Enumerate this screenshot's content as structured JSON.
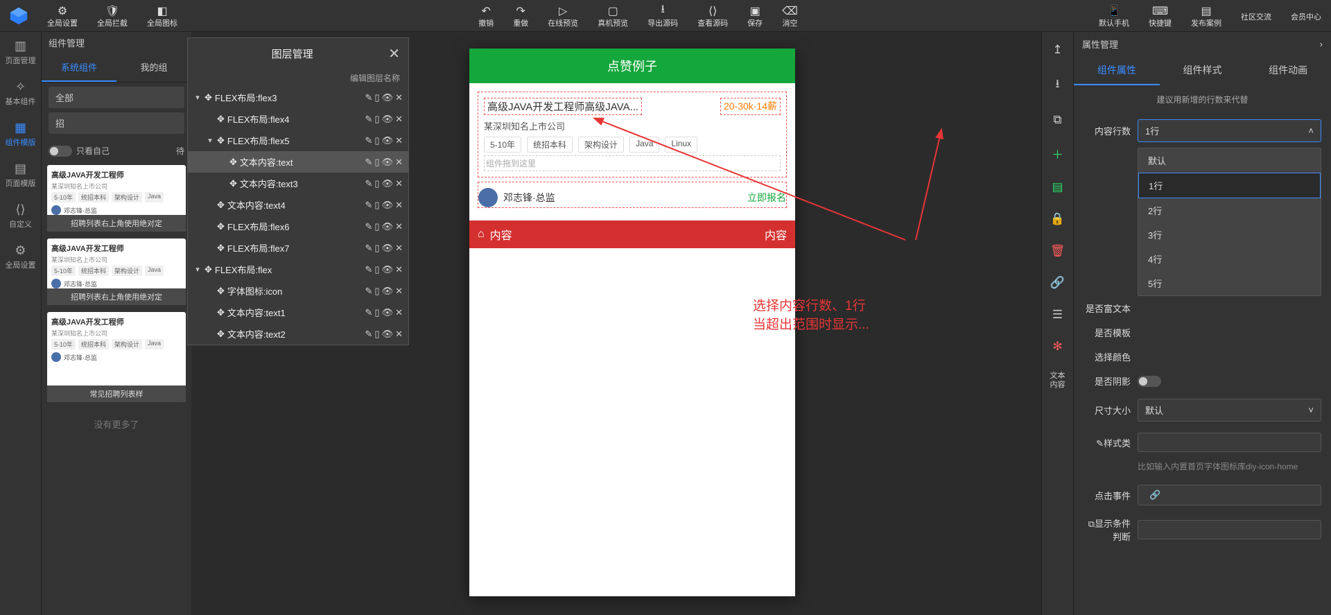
{
  "topbar": {
    "groupA": [
      "全局设置",
      "全局拦截",
      "全局图标"
    ],
    "center": [
      "撤销",
      "重做",
      "在线预览",
      "真机预览",
      "导出源码",
      "查看源码",
      "保存",
      "消空"
    ],
    "right": [
      "默认手机",
      "快捷键",
      "发布案例",
      "社区交流",
      "会员中心"
    ]
  },
  "left_rail": {
    "items": [
      "页面管理",
      "基本组件",
      "组件模版",
      "页面模版",
      "自定义",
      "全局设置"
    ],
    "active": 2
  },
  "comp_panel": {
    "title": "组件管理",
    "tabs": {
      "a": "系统组件",
      "b": "我的组"
    },
    "filter_all": "全部",
    "filter_search": "招",
    "toggle_label": "只看自己",
    "toggle_suffix": "待",
    "card": {
      "title": "高级JAVA开发工程师",
      "company": "某深圳知名上市公司",
      "tags": [
        "5-10年",
        "统招本科",
        "架构设计",
        "Java"
      ],
      "person": "邓志锋·总监"
    },
    "caption1": "招聘列表右上角使用绝对定",
    "caption2": "招聘列表右上角使用绝对定",
    "caption3": "常见招聘列表样",
    "nomore": "没有更多了"
  },
  "layer": {
    "title": "图层管理",
    "edit": "编辑图层名称",
    "rows": [
      {
        "depth": 0,
        "exp": "▾",
        "label": "FLEX布局:flex3",
        "sel": false
      },
      {
        "depth": 1,
        "exp": "",
        "label": "FLEX布局:flex4",
        "sel": false
      },
      {
        "depth": 1,
        "exp": "▾",
        "label": "FLEX布局:flex5",
        "sel": false
      },
      {
        "depth": 2,
        "exp": "",
        "label": "文本内容:text",
        "sel": true
      },
      {
        "depth": 2,
        "exp": "",
        "label": "文本内容:text3",
        "sel": false
      },
      {
        "depth": 1,
        "exp": "",
        "label": "文本内容:text4",
        "sel": false
      },
      {
        "depth": 1,
        "exp": "",
        "label": "FLEX布局:flex6",
        "sel": false
      },
      {
        "depth": 1,
        "exp": "",
        "label": "FLEX布局:flex7",
        "sel": false
      },
      {
        "depth": 0,
        "exp": "▾",
        "label": "FLEX布局:flex",
        "sel": false
      },
      {
        "depth": 1,
        "exp": "",
        "label": "字体图标:icon",
        "sel": false
      },
      {
        "depth": 1,
        "exp": "",
        "label": "文本内容:text1",
        "sel": false
      },
      {
        "depth": 1,
        "exp": "",
        "label": "文本内容:text2",
        "sel": false
      }
    ]
  },
  "phone": {
    "header": "点赞例子",
    "job_title": "高级JAVA开发工程师高级JAVA...",
    "salary": "20-30k·14薪",
    "company": "某深圳知名上市公司",
    "tags": [
      "5-10年",
      "统招本科",
      "架构设计",
      "Java",
      "Linux"
    ],
    "drag_hint": "组件拖到这里",
    "person": "邓志锋·总监",
    "apply": "立即报名",
    "red_label": "内容",
    "red_right": "内容"
  },
  "anno": {
    "line1": "选择内容行数、1行",
    "line2": "当超出范围时显示..."
  },
  "rvbar_text": "文本\n内容",
  "rpanel": {
    "title": "属性管理",
    "tabs": [
      "组件属性",
      "组件样式",
      "组件动画"
    ],
    "hint": "建议用新增的行数来代替",
    "f_lines": {
      "label": "内容行数",
      "value": "1行",
      "options": [
        "默认",
        "1行",
        "2行",
        "3行",
        "4行",
        "5行"
      ],
      "selected": "1行"
    },
    "f_rich": {
      "label": "是否富文本"
    },
    "f_tpl": {
      "label": "是否模板"
    },
    "f_color": {
      "label": "选择颜色"
    },
    "f_shadow": {
      "label": "是否阴影"
    },
    "f_size": {
      "label": "尺寸大小",
      "value": "默认"
    },
    "f_class": {
      "label": "样式类"
    },
    "f_class_hint": "比如输入内置首页字体图标库diy-icon-home",
    "f_click": {
      "label": "点击事件"
    },
    "f_cond": {
      "label": "显示条件判断"
    }
  }
}
